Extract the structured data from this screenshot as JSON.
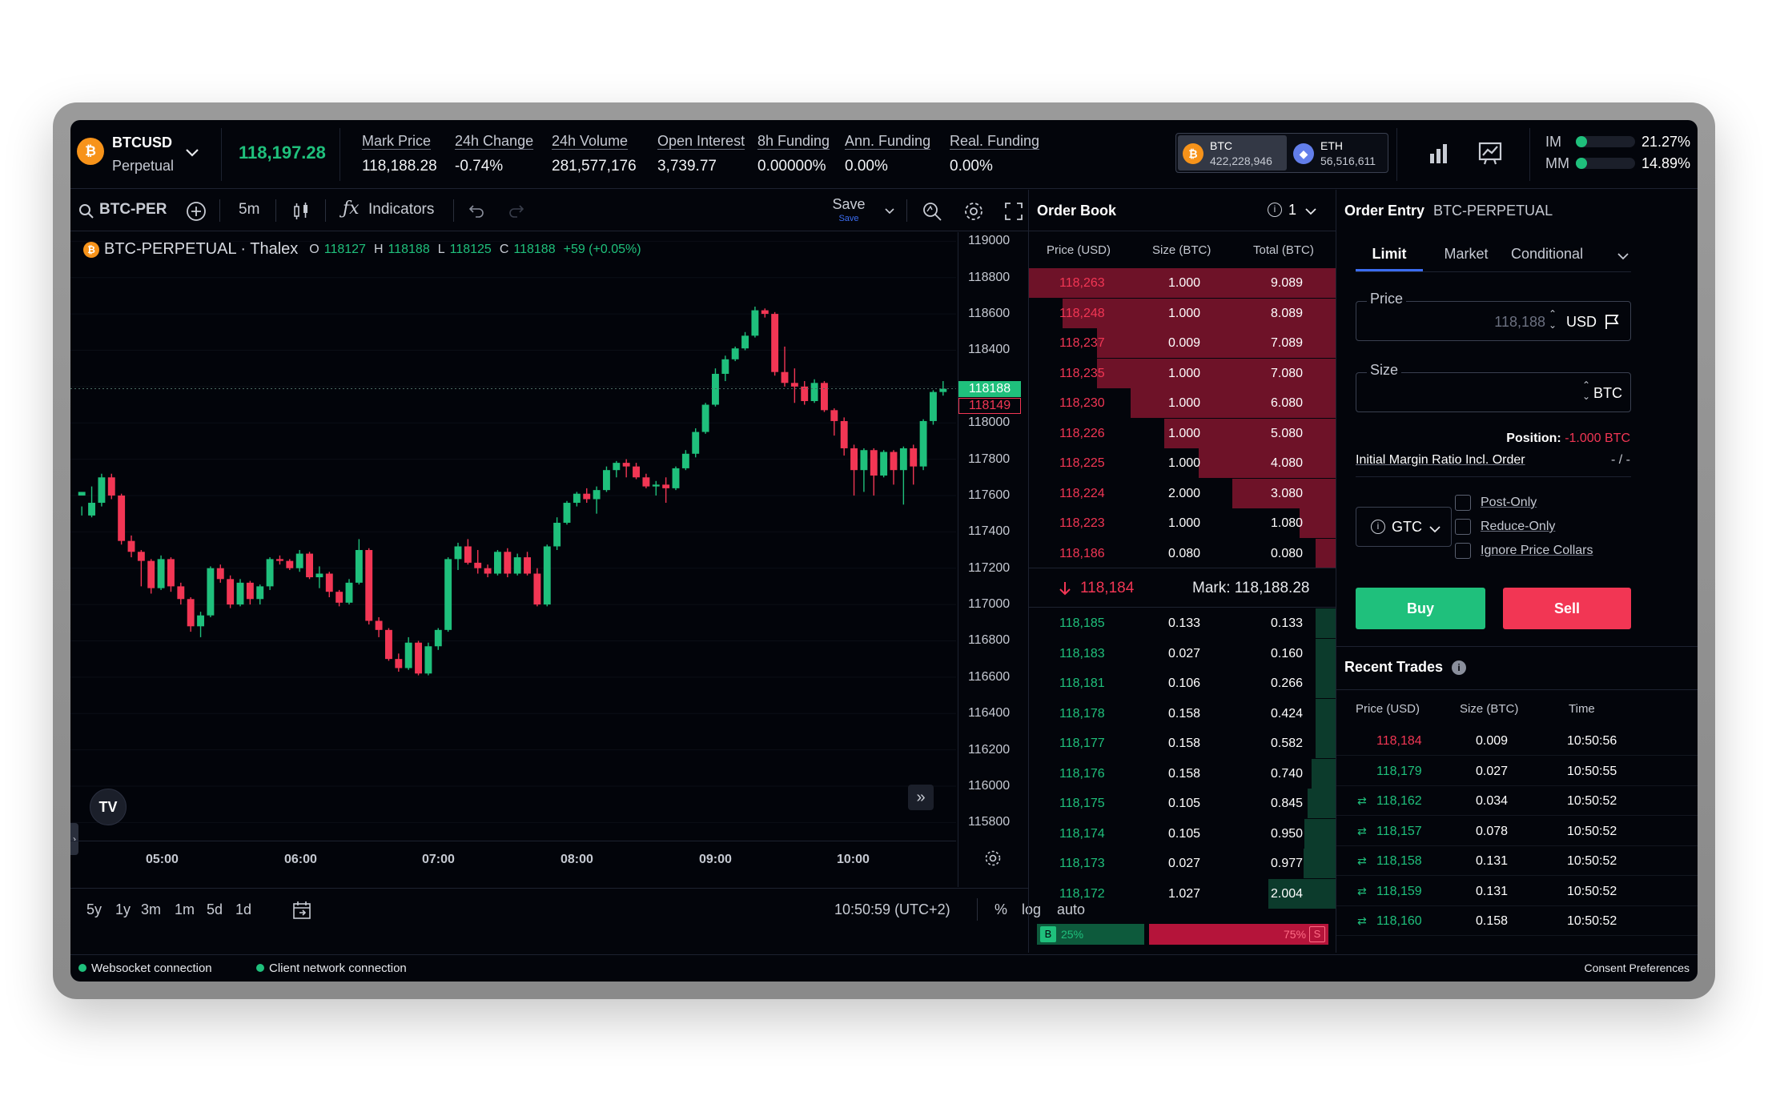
{
  "header": {
    "symbol": "BTCUSD",
    "symbol_sub": "Perpetual",
    "last_price": "118,197.28",
    "stats": [
      {
        "label": "Mark Price",
        "value": "118,188.28",
        "color": "normal"
      },
      {
        "label": "24h Change",
        "value": "-0.74%",
        "color": "red"
      },
      {
        "label": "24h Volume",
        "value": "281,577,176",
        "color": "normal"
      },
      {
        "label": "Open Interest",
        "value": "3,739.77",
        "color": "normal"
      },
      {
        "label": "8h Funding",
        "value": "0.00000%",
        "color": "normal"
      },
      {
        "label": "Ann. Funding",
        "value": "0.00%",
        "color": "normal"
      },
      {
        "label": "Real. Funding",
        "value": "0.00%",
        "color": "normal"
      }
    ],
    "wallets": [
      {
        "coin": "BTC",
        "value": "422,228,946",
        "icon": "bitcoin-icon"
      },
      {
        "coin": "ETH",
        "value": "56,516,611",
        "icon": "ethereum-icon"
      }
    ],
    "margin": [
      {
        "label": "IM",
        "value": "21.27%",
        "fill": 0.2127
      },
      {
        "label": "MM",
        "value": "14.89%",
        "fill": 0.1489
      }
    ]
  },
  "chart_toolbar": {
    "search": "BTC-PER",
    "interval": "5m",
    "indicators": "Indicators",
    "save": "Save",
    "save_sub": "Save"
  },
  "chart_legend": {
    "title": "BTC-PERPETUAL · Thalex",
    "o_label": "O",
    "o": "118127",
    "h_label": "H",
    "h": "118188",
    "l_label": "L",
    "l": "118125",
    "c_label": "C",
    "c": "118188",
    "change": "+59 (+0.05%)"
  },
  "chart_bottom": {
    "ranges": [
      "5y",
      "1y",
      "3m",
      "1m",
      "5d",
      "1d"
    ],
    "clock": "10:50:59 (UTC+2)",
    "pct": "%",
    "log": "log",
    "auto": "auto"
  },
  "chart_data": {
    "type": "candlestick",
    "x_ticks": [
      "05:00",
      "06:00",
      "07:00",
      "08:00",
      "09:00",
      "10:00"
    ],
    "y_ticks": [
      119000,
      118800,
      118600,
      118400,
      118200,
      118000,
      117800,
      117600,
      117400,
      117200,
      117000,
      116800,
      116600,
      116400,
      116200,
      116000,
      115800
    ],
    "ylim": [
      115700,
      119050
    ],
    "last_price_label": "118188",
    "mark_price_label": "118149",
    "colors": {
      "up": "#1fc07c",
      "down": "#f23654"
    },
    "candles": [
      [
        117600,
        117620,
        117540,
        117490
      ],
      [
        117490,
        117560,
        117650,
        117480
      ],
      [
        117560,
        117700,
        117720,
        117540
      ],
      [
        117700,
        117600,
        117720,
        117580
      ],
      [
        117600,
        117350,
        117610,
        117330
      ],
      [
        117350,
        117290,
        117380,
        117260
      ],
      [
        117290,
        117240,
        117300,
        117100
      ],
      [
        117240,
        117090,
        117250,
        117060
      ],
      [
        117090,
        117250,
        117270,
        117080
      ],
      [
        117250,
        117100,
        117260,
        117070
      ],
      [
        117100,
        117030,
        117120,
        117000
      ],
      [
        117030,
        116880,
        117040,
        116850
      ],
      [
        116880,
        116940,
        116960,
        116820
      ],
      [
        116940,
        117200,
        117210,
        116930
      ],
      [
        117200,
        117140,
        117220,
        117120
      ],
      [
        117140,
        117000,
        117160,
        116980
      ],
      [
        117000,
        117120,
        117140,
        116990
      ],
      [
        117120,
        117030,
        117130,
        117000
      ],
      [
        117030,
        117100,
        117110,
        117000
      ],
      [
        117100,
        117250,
        117260,
        117080
      ],
      [
        117250,
        117240,
        117270,
        117220
      ],
      [
        117240,
        117200,
        117250,
        117190
      ],
      [
        117200,
        117280,
        117300,
        117180
      ],
      [
        117280,
        117150,
        117290,
        117140
      ],
      [
        117150,
        117170,
        117210,
        117090
      ],
      [
        117170,
        117070,
        117180,
        117040
      ],
      [
        117070,
        117010,
        117080,
        116990
      ],
      [
        117010,
        117120,
        117140,
        117000
      ],
      [
        117120,
        117300,
        117360,
        117110
      ],
      [
        117300,
        116910,
        117310,
        116890
      ],
      [
        116910,
        116860,
        116930,
        116820
      ],
      [
        116860,
        116700,
        116870,
        116690
      ],
      [
        116700,
        116650,
        116730,
        116630
      ],
      [
        116650,
        116790,
        116820,
        116640
      ],
      [
        116790,
        116620,
        116800,
        116610
      ],
      [
        116620,
        116770,
        116790,
        116610
      ],
      [
        116770,
        116860,
        116870,
        116750
      ],
      [
        116860,
        117250,
        117260,
        116850
      ],
      [
        117250,
        117320,
        117340,
        117190
      ],
      [
        117320,
        117230,
        117360,
        117220
      ],
      [
        117230,
        117200,
        117300,
        117170
      ],
      [
        117200,
        117170,
        117220,
        117150
      ],
      [
        117170,
        117290,
        117300,
        117160
      ],
      [
        117290,
        117170,
        117310,
        117150
      ],
      [
        117170,
        117260,
        117280,
        117160
      ],
      [
        117260,
        117170,
        117290,
        117160
      ],
      [
        117170,
        117000,
        117200,
        116990
      ],
      [
        117000,
        117320,
        117330,
        116990
      ],
      [
        117320,
        117450,
        117480,
        117300
      ],
      [
        117450,
        117560,
        117570,
        117440
      ],
      [
        117560,
        117610,
        117620,
        117540
      ],
      [
        117610,
        117580,
        117640,
        117560
      ],
      [
        117580,
        117630,
        117650,
        117500
      ],
      [
        117630,
        117740,
        117760,
        117620
      ],
      [
        117740,
        117780,
        117790,
        117700
      ],
      [
        117780,
        117760,
        117800,
        117700
      ],
      [
        117760,
        117700,
        117780,
        117690
      ],
      [
        117700,
        117650,
        117720,
        117640
      ],
      [
        117650,
        117660,
        117680,
        117600
      ],
      [
        117660,
        117640,
        117700,
        117560
      ],
      [
        117640,
        117750,
        117760,
        117630
      ],
      [
        117750,
        117830,
        117850,
        117740
      ],
      [
        117830,
        117950,
        117970,
        117810
      ],
      [
        117950,
        118100,
        118110,
        117940
      ],
      [
        118100,
        118270,
        118300,
        118090
      ],
      [
        118270,
        118350,
        118370,
        118230
      ],
      [
        118350,
        118410,
        118420,
        118340
      ],
      [
        118410,
        118480,
        118500,
        118400
      ],
      [
        118480,
        118620,
        118640,
        118470
      ],
      [
        118620,
        118600,
        118630,
        118580
      ],
      [
        118600,
        118280,
        118610,
        118260
      ],
      [
        118280,
        118220,
        118420,
        118200
      ],
      [
        118220,
        118200,
        118300,
        118110
      ],
      [
        118200,
        118120,
        118230,
        118100
      ],
      [
        118120,
        118220,
        118240,
        118110
      ],
      [
        118220,
        118070,
        118230,
        118060
      ],
      [
        118070,
        118010,
        118080,
        117930
      ],
      [
        118010,
        117860,
        118030,
        117820
      ],
      [
        117860,
        117740,
        117880,
        117600
      ],
      [
        117740,
        117850,
        117860,
        117620
      ],
      [
        117850,
        117710,
        117860,
        117600
      ],
      [
        117710,
        117840,
        117850,
        117700
      ],
      [
        117840,
        117740,
        117850,
        117660
      ],
      [
        117740,
        117860,
        117870,
        117550
      ],
      [
        117860,
        117760,
        117880,
        117660
      ],
      [
        117760,
        118010,
        118020,
        117740
      ],
      [
        118010,
        118170,
        118180,
        117990
      ],
      [
        118170,
        118188,
        118230,
        118150
      ]
    ]
  },
  "order_book": {
    "title": "Order Book",
    "grouping": "1",
    "columns": [
      "Price (USD)",
      "Size (BTC)",
      "Total (BTC)"
    ],
    "asks": [
      {
        "price": "118,263",
        "size": "1.000",
        "total": "9.089",
        "depth": 9.089
      },
      {
        "price": "118,248",
        "size": "1.000",
        "total": "8.089",
        "depth": 8.089
      },
      {
        "price": "118,237",
        "size": "0.009",
        "total": "7.089",
        "depth": 7.089
      },
      {
        "price": "118,235",
        "size": "1.000",
        "total": "7.080",
        "depth": 7.08
      },
      {
        "price": "118,230",
        "size": "1.000",
        "total": "6.080",
        "depth": 6.08
      },
      {
        "price": "118,226",
        "size": "1.000",
        "total": "5.080",
        "depth": 5.08
      },
      {
        "price": "118,225",
        "size": "1.000",
        "total": "4.080",
        "depth": 4.08
      },
      {
        "price": "118,224",
        "size": "2.000",
        "total": "3.080",
        "depth": 3.08
      },
      {
        "price": "118,223",
        "size": "1.000",
        "total": "1.080",
        "depth": 1.08
      },
      {
        "price": "118,186",
        "size": "0.080",
        "total": "0.080",
        "depth": 0.08
      }
    ],
    "spread_price": "118,184",
    "mark_label": "Mark: 118,188.28",
    "bids": [
      {
        "price": "118,185",
        "size": "0.133",
        "total": "0.133",
        "depth": 0.133
      },
      {
        "price": "118,183",
        "size": "0.027",
        "total": "0.160",
        "depth": 0.16
      },
      {
        "price": "118,181",
        "size": "0.106",
        "total": "0.266",
        "depth": 0.266
      },
      {
        "price": "118,178",
        "size": "0.158",
        "total": "0.424",
        "depth": 0.424
      },
      {
        "price": "118,177",
        "size": "0.158",
        "total": "0.582",
        "depth": 0.582
      },
      {
        "price": "118,176",
        "size": "0.158",
        "total": "0.740",
        "depth": 0.74
      },
      {
        "price": "118,175",
        "size": "0.105",
        "total": "0.845",
        "depth": 0.845
      },
      {
        "price": "118,174",
        "size": "0.105",
        "total": "0.950",
        "depth": 0.95
      },
      {
        "price": "118,173",
        "size": "0.027",
        "total": "0.977",
        "depth": 0.977
      },
      {
        "price": "118,172",
        "size": "1.027",
        "total": "2.004",
        "depth": 2.004
      }
    ],
    "max_depth": 9.089,
    "ratio_buy_label": "B",
    "ratio_buy": "25%",
    "ratio_sell_label": "S",
    "ratio_sell": "75%",
    "ratio_buy_fraction": 0.25
  },
  "order_entry": {
    "title": "Order Entry",
    "instrument": "BTC-PERPETUAL",
    "tabs": [
      "Limit",
      "Market",
      "Conditional"
    ],
    "price_label": "Price",
    "price_placeholder": "118,188",
    "price_unit": "USD",
    "size_label": "Size",
    "size_unit": "BTC",
    "position_label": "Position:",
    "position_value": "-1.000 BTC",
    "imr_label": "Initial Margin Ratio Incl. Order",
    "imr_value": "- / -",
    "tif": "GTC",
    "options": [
      "Post-Only",
      "Reduce-Only",
      "Ignore Price Collars"
    ],
    "buy": "Buy",
    "sell": "Sell"
  },
  "recent_trades": {
    "title": "Recent Trades",
    "columns": [
      "Price (USD)",
      "Size (BTC)",
      "Time"
    ],
    "rows": [
      {
        "price": "118,184",
        "size": "0.009",
        "time": "10:50:56",
        "side": "sell",
        "swap": false
      },
      {
        "price": "118,179",
        "size": "0.027",
        "time": "10:50:55",
        "side": "buy",
        "swap": false
      },
      {
        "price": "118,162",
        "size": "0.034",
        "time": "10:50:52",
        "side": "buy",
        "swap": true
      },
      {
        "price": "118,157",
        "size": "0.078",
        "time": "10:50:52",
        "side": "buy",
        "swap": true
      },
      {
        "price": "118,158",
        "size": "0.131",
        "time": "10:50:52",
        "side": "buy",
        "swap": true
      },
      {
        "price": "118,159",
        "size": "0.131",
        "time": "10:50:52",
        "side": "buy",
        "swap": true
      },
      {
        "price": "118,160",
        "size": "0.158",
        "time": "10:50:52",
        "side": "buy",
        "swap": true
      }
    ]
  },
  "status": {
    "websocket": "Websocket connection",
    "client": "Client network connection",
    "consent": "Consent Preferences"
  }
}
